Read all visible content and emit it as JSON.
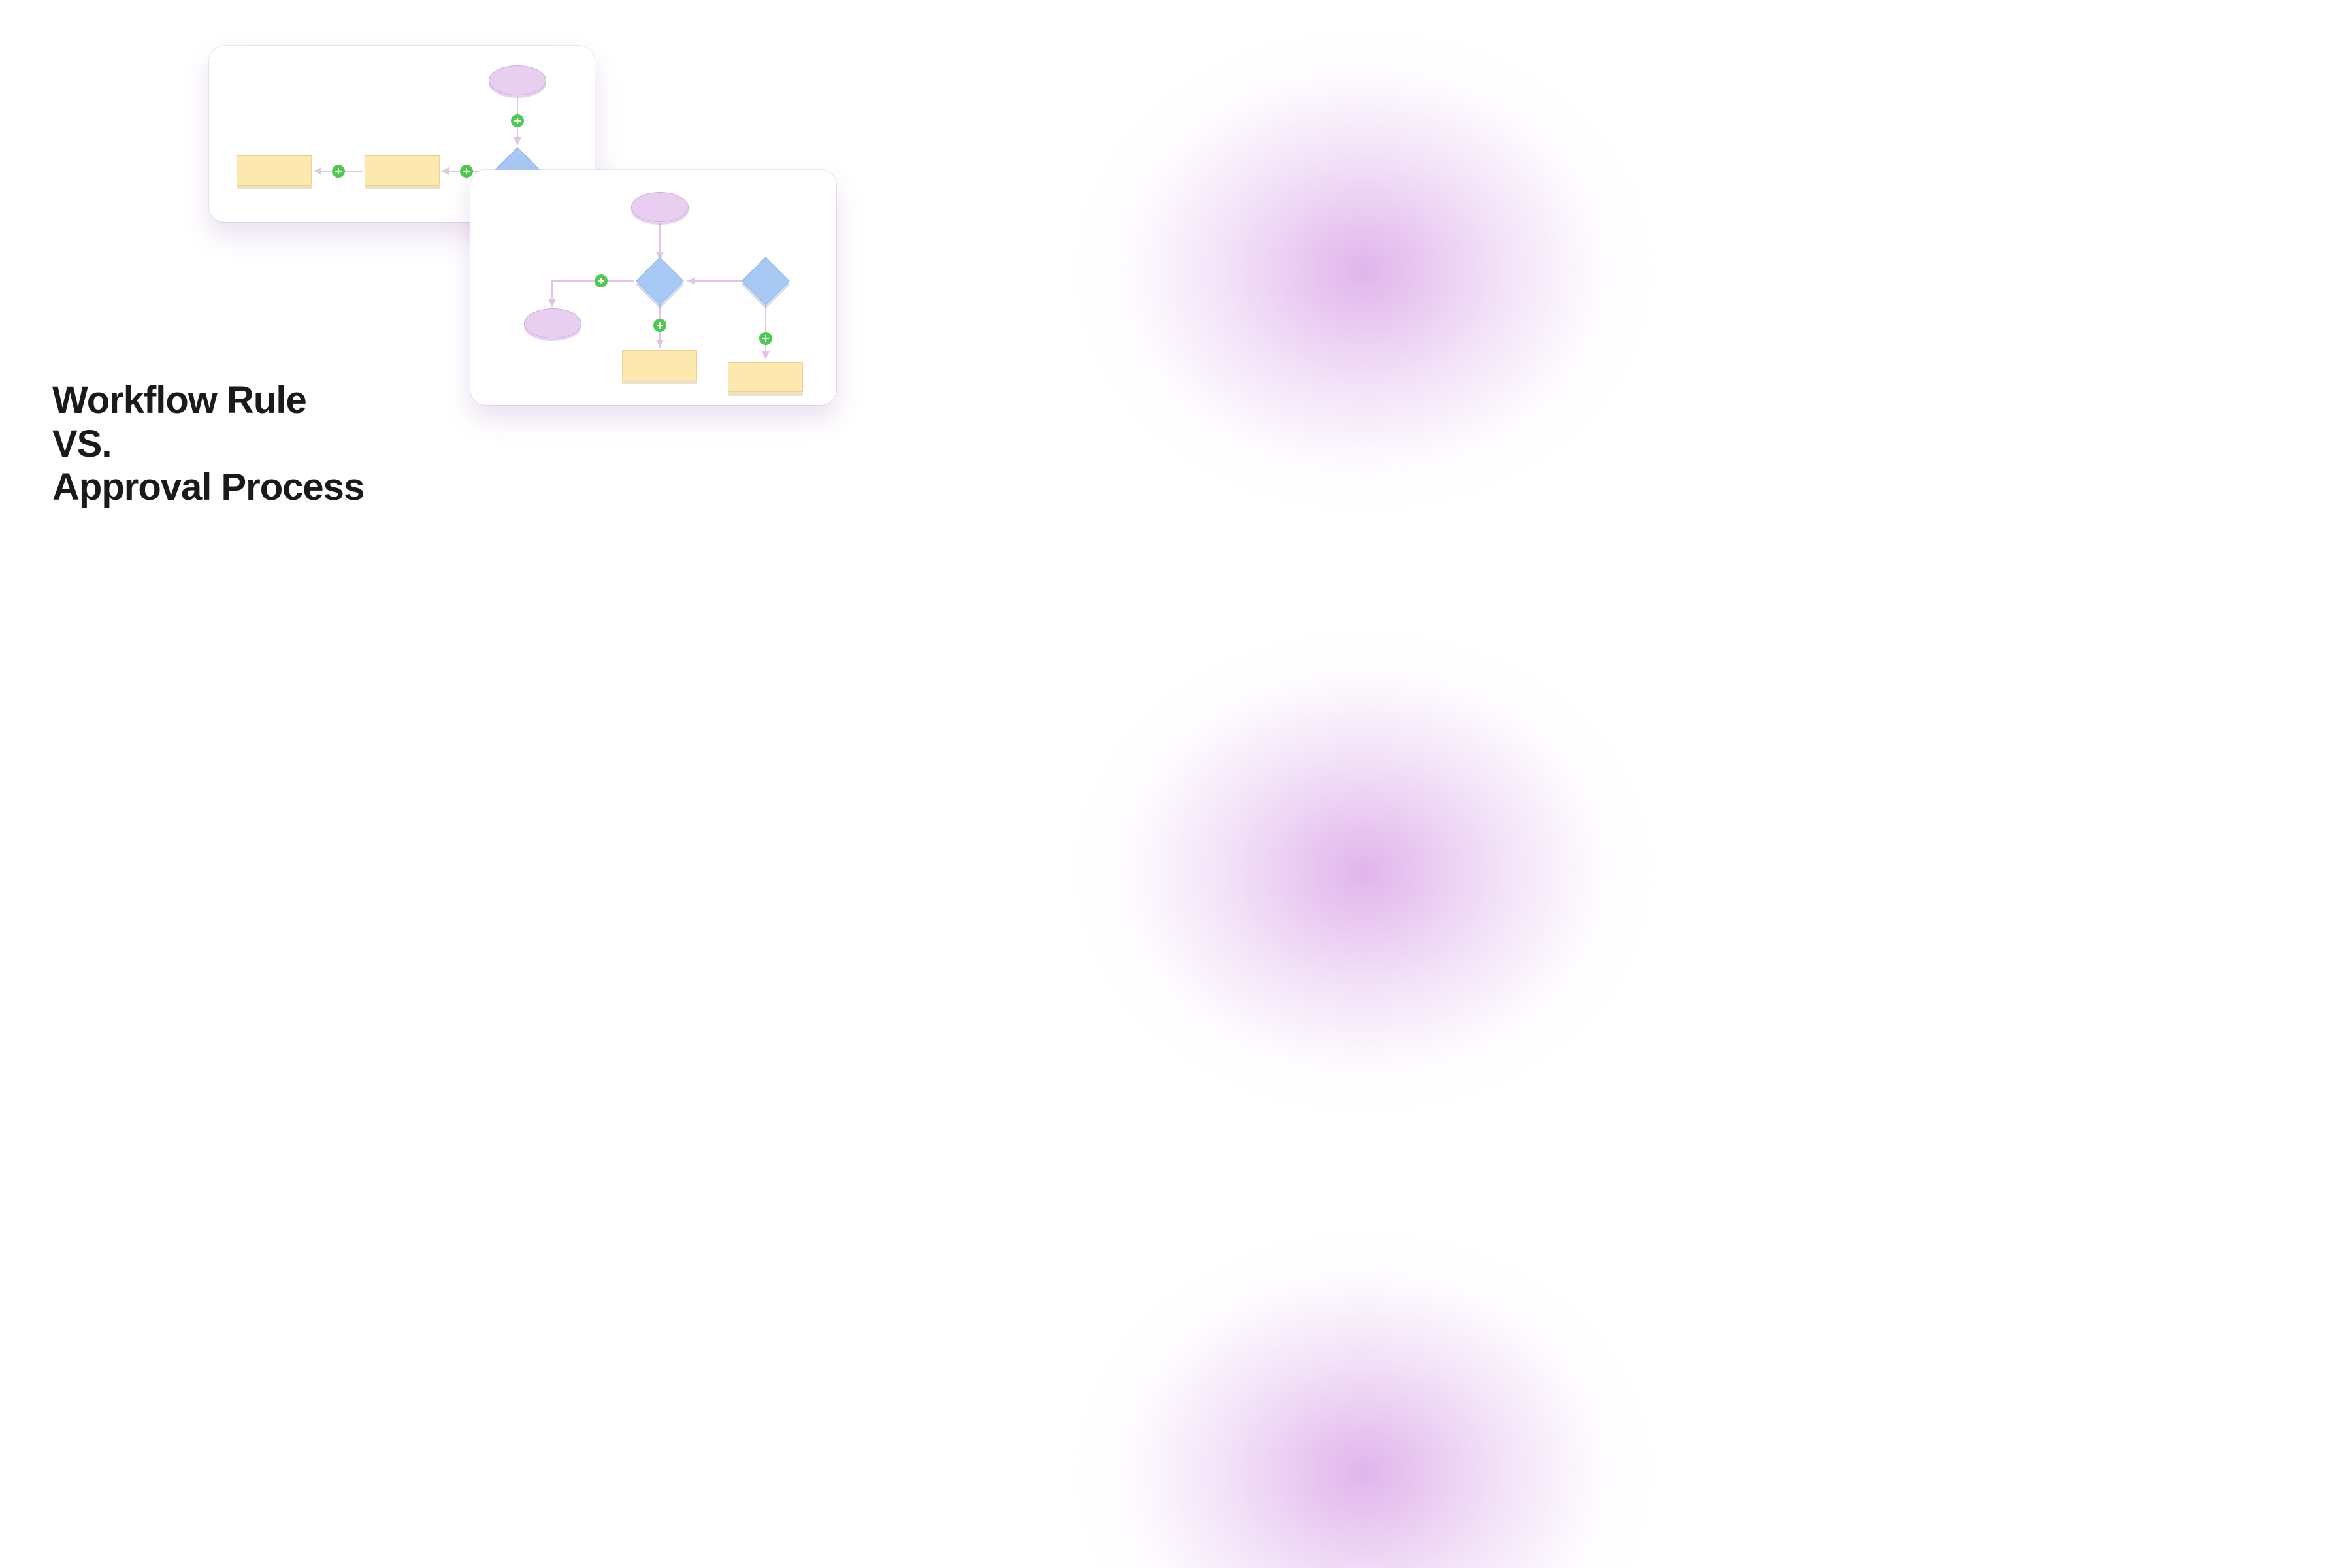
{
  "heading": {
    "line1": "Workflow Rule",
    "line2": "VS.",
    "line3": "Approval Process"
  },
  "colors": {
    "ellipse_fill": "#e8cff0",
    "diamond_fill": "#a8c9f3",
    "rect_fill": "#fde8b0",
    "plus_fill": "#4fc94f",
    "connector": "#e8cde8"
  },
  "diagram_top": {
    "type": "workflow-rule",
    "nodes": [
      {
        "shape": "ellipse",
        "name": "start-node"
      },
      {
        "shape": "diamond",
        "name": "decision-node"
      },
      {
        "shape": "rect",
        "name": "action-node-1"
      },
      {
        "shape": "rect",
        "name": "action-node-2"
      }
    ],
    "connectors": [
      {
        "from": "start-node",
        "to": "decision-node",
        "plus": true
      },
      {
        "from": "decision-node",
        "to": "action-node-1",
        "plus": true
      },
      {
        "from": "action-node-1",
        "to": "action-node-2",
        "plus": true
      }
    ]
  },
  "diagram_bottom": {
    "type": "approval-process",
    "nodes": [
      {
        "shape": "ellipse",
        "name": "start-node"
      },
      {
        "shape": "diamond",
        "name": "decision-node-1"
      },
      {
        "shape": "diamond",
        "name": "decision-node-2"
      },
      {
        "shape": "ellipse",
        "name": "terminal-node"
      },
      {
        "shape": "rect",
        "name": "action-node-1"
      },
      {
        "shape": "rect",
        "name": "action-node-2"
      }
    ],
    "connectors": [
      {
        "from": "start-node",
        "to": "decision-node-1",
        "plus": false
      },
      {
        "from": "decision-node-2",
        "to": "decision-node-1",
        "plus": false
      },
      {
        "from": "decision-node-1",
        "to": "terminal-node",
        "plus": true
      },
      {
        "from": "decision-node-1",
        "to": "action-node-1",
        "plus": true
      },
      {
        "from": "decision-node-2",
        "to": "action-node-2",
        "plus": true
      }
    ]
  }
}
